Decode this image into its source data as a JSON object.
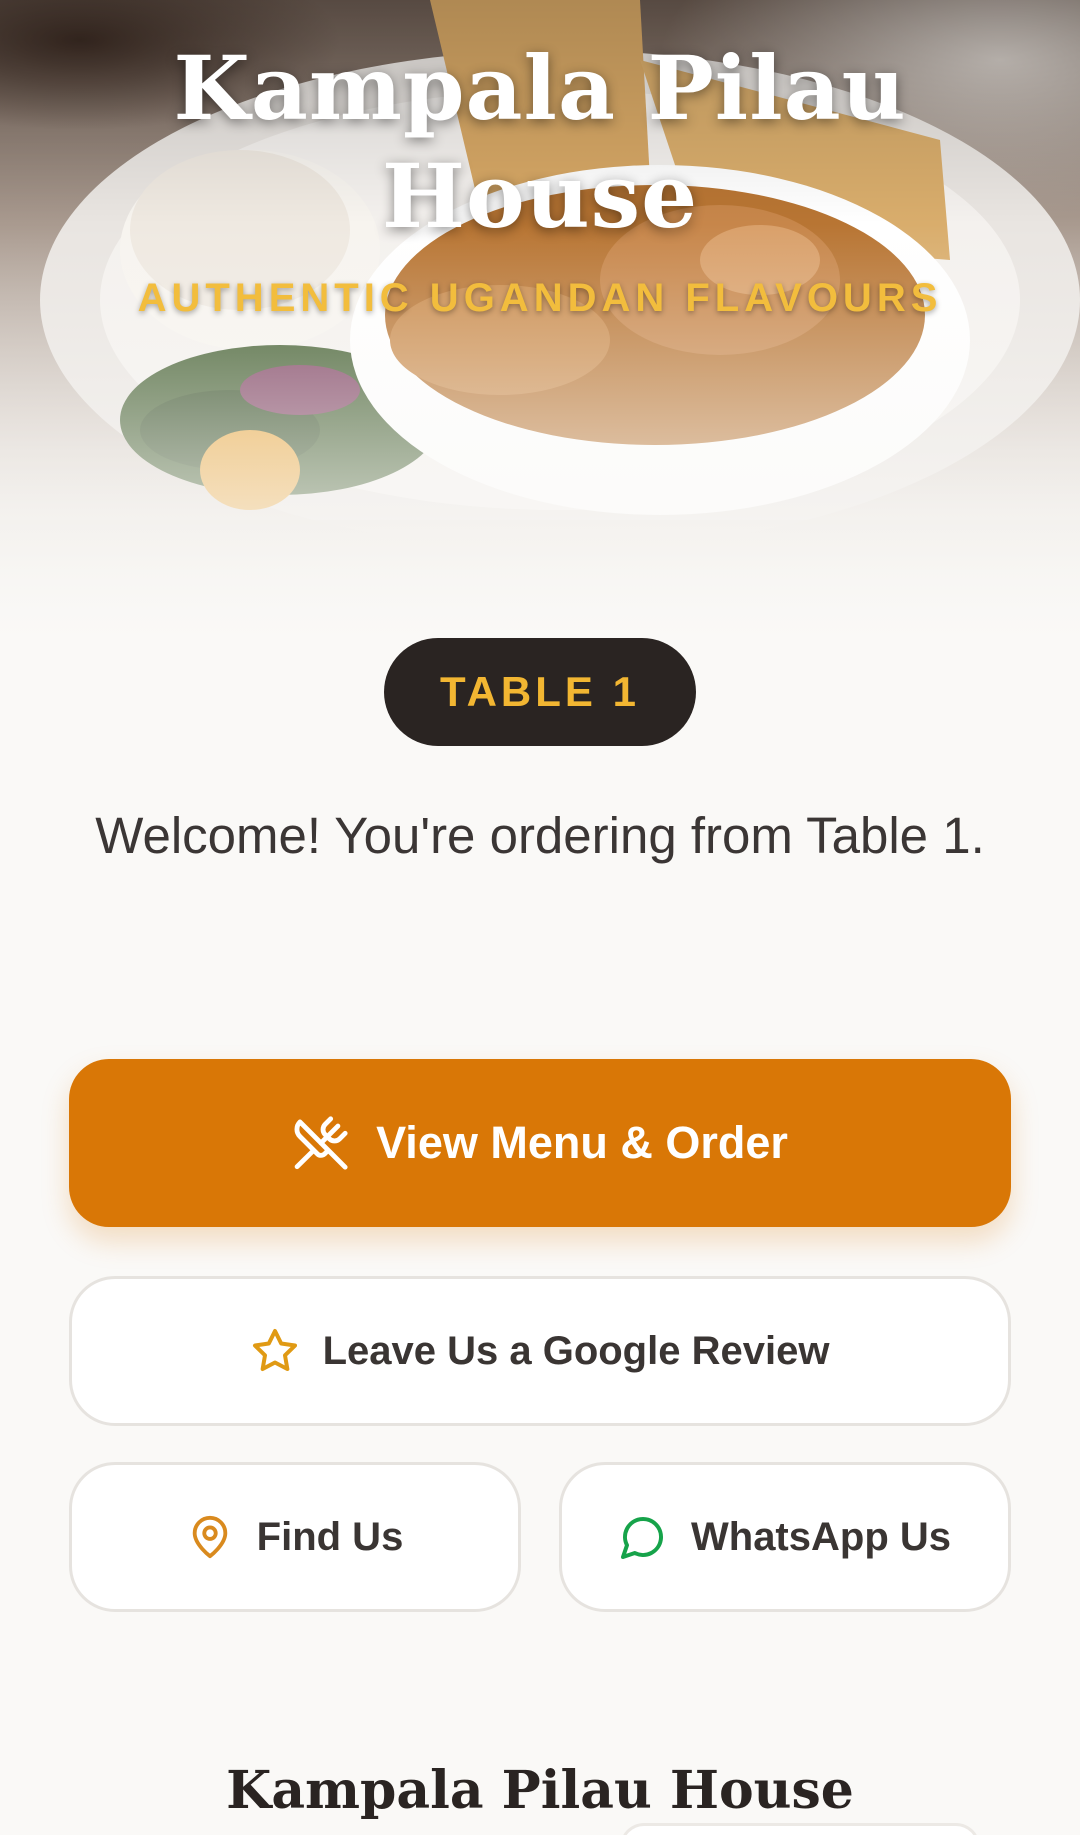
{
  "restaurant": {
    "name": "Kampala Pilau House",
    "tagline": "AUTHENTIC UGANDAN FLAVOURS"
  },
  "table": {
    "badge_label": "TABLE 1"
  },
  "welcome_message": "Welcome! You're ordering from Table 1.",
  "actions": {
    "primary": {
      "label": "View Menu & Order",
      "icon": "utensils-crossed-icon"
    },
    "review": {
      "label": "Leave Us a Google Review",
      "icon": "star-icon"
    },
    "find": {
      "label": "Find Us",
      "icon": "map-pin-icon"
    },
    "whatsapp": {
      "label": "WhatsApp Us",
      "icon": "message-circle-icon"
    }
  },
  "footer": {
    "name": "Kampala Pilau House"
  },
  "colors": {
    "accent": "#d97706",
    "gold": "#f2b632",
    "badge_bg": "#2a2422",
    "whatsapp_green": "#16a34a"
  }
}
